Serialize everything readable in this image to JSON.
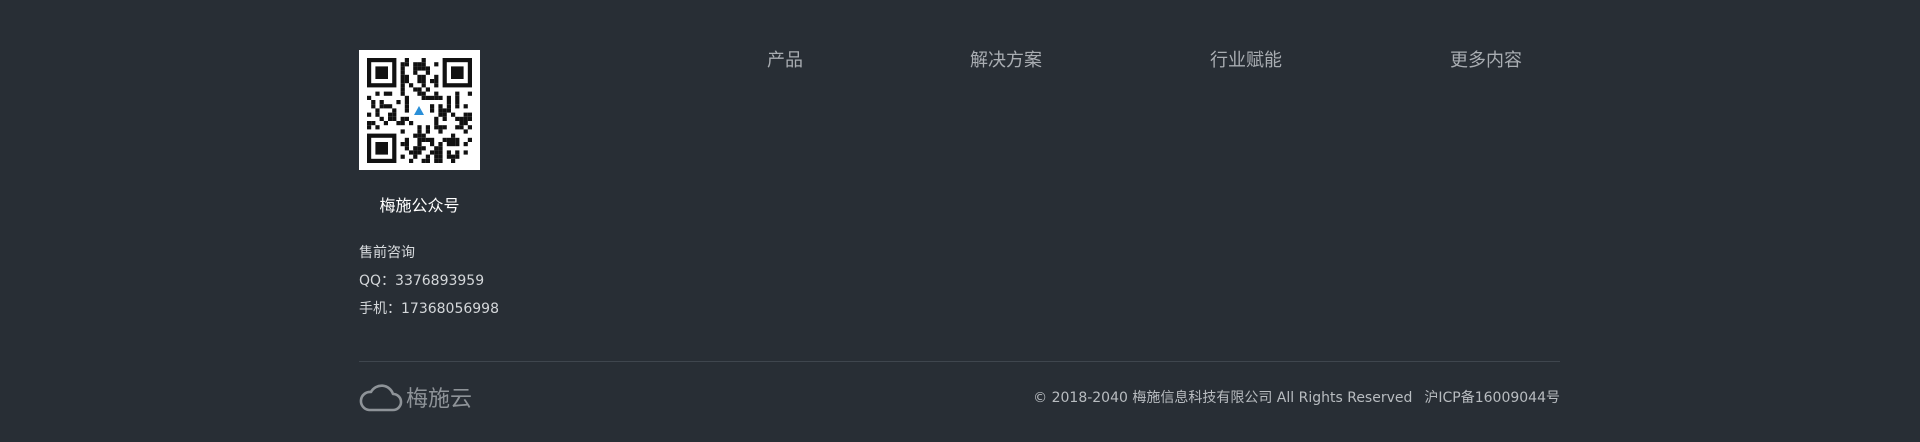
{
  "qr": {
    "caption": "梅施公众号"
  },
  "contact": {
    "title": "售前咨询",
    "qq": "QQ：3376893959",
    "phone": "手机：17368056998"
  },
  "nav": {
    "products": "产品",
    "solutions": "解决方案",
    "industry": "行业赋能",
    "more": "更多内容"
  },
  "brand": {
    "name": "梅施云"
  },
  "legal": {
    "copyright": "© 2018-2040 梅施信息科技有限公司 All Rights Reserved",
    "icp": "沪ICP备16009044号"
  },
  "colors": {
    "background": "#282e35",
    "nav_text": "#a9adb2",
    "divider": "#3f464e",
    "logo": "#8e9398"
  }
}
